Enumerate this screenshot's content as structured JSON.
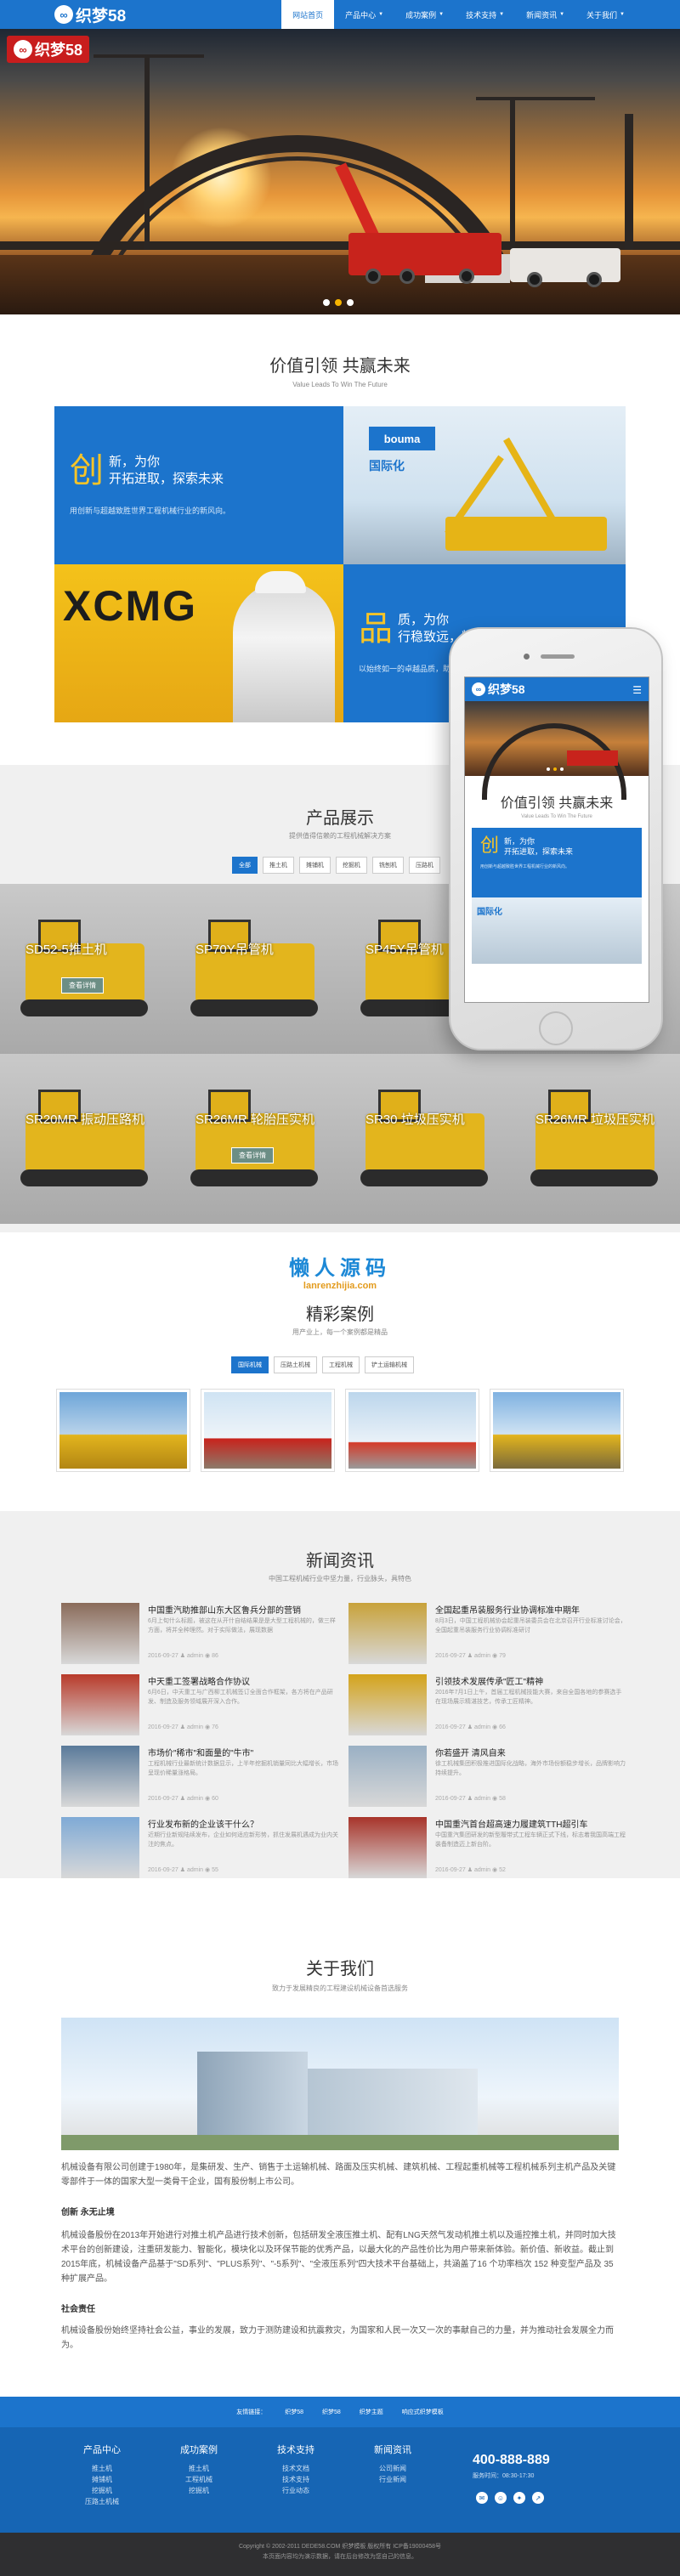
{
  "header": {
    "logo_text": "织梦58",
    "nav": [
      {
        "label": "网站首页",
        "active": true,
        "dropdown": false
      },
      {
        "label": "产品中心",
        "active": false,
        "dropdown": true
      },
      {
        "label": "成功案例",
        "active": false,
        "dropdown": true
      },
      {
        "label": "技术支持",
        "active": false,
        "dropdown": true
      },
      {
        "label": "新闻资讯",
        "active": false,
        "dropdown": true
      },
      {
        "label": "关于我们",
        "active": false,
        "dropdown": true
      }
    ]
  },
  "hero": {
    "logo_text": "织梦58",
    "slide_count": 3,
    "active_slide": 2
  },
  "value": {
    "title": "价值引领 共赢未来",
    "subtitle": "Value Leads To Win The Future",
    "block1": {
      "big": "创",
      "line1": "新，为你",
      "line2": "开拓进取，探索未来",
      "desc": "用创新与超越致胜世界工程机械行业的新风向。"
    },
    "block2": {
      "big": "品",
      "line1": "质，为你",
      "line2": "行稳致远，精益求精",
      "desc": "以始终如一的卓越品质，助力客户成就非凡未来。"
    },
    "bouma_label": "国际化",
    "xcmg_label": "XCMG"
  },
  "products": {
    "title": "产品展示",
    "subtitle": "提供值得信赖的工程机械解决方案",
    "tabs": [
      "全部",
      "推土机",
      "摊铺机",
      "挖掘机",
      "铣刨机",
      "压路机"
    ],
    "items": [
      {
        "name": "SD52-5推土机",
        "show_btn": true,
        "btn": "查看详情"
      },
      {
        "name": "SP70Y吊管机",
        "show_btn": false,
        "btn": ""
      },
      {
        "name": "SP45Y吊管机",
        "show_btn": false,
        "btn": ""
      },
      {
        "name": "",
        "show_btn": false,
        "btn": ""
      },
      {
        "name": "SR20MR 振动压路机",
        "show_btn": false,
        "btn": ""
      },
      {
        "name": "SR26MR 轮胎压实机",
        "show_btn": true,
        "btn": "查看详情"
      },
      {
        "name": "SR30 垃圾压实机",
        "show_btn": false,
        "btn": ""
      },
      {
        "name": "SR26MR 垃圾压实机",
        "show_btn": false,
        "btn": ""
      }
    ]
  },
  "phone": {
    "logo_text": "织梦58",
    "title": "价值引领 共赢未来",
    "subtitle": "Value Leads To Win The Future",
    "big": "创",
    "line1": "新，为你",
    "line2": "开拓进取，探索未来",
    "desc": "用创新与超越致胜世界工程机械行业的新风向。",
    "img_label": "国际化"
  },
  "watermark": {
    "line1": "懒人源码",
    "line2": "lanrenzhijia.com"
  },
  "cases": {
    "title": "精彩案例",
    "subtitle": "用产业上，每一个案例都是精品",
    "tabs": [
      "国际机械",
      "压路土机械",
      "工程机械",
      "铲土运输机械"
    ]
  },
  "news": {
    "title": "新闻资讯",
    "subtitle": "中国工程机械行业中坚力量，行业脉头，具特色",
    "items": [
      {
        "title": "中国重汽助推部山东大区鲁兵分部的营销",
        "desc": "6月上旬什么标题，被这在从开什自结结果是是大型工程机械的，做三样方面，将并全种理然。对于实际做法，展现数据",
        "date": "2016-09-27",
        "author": "admin",
        "views": "86"
      },
      {
        "title": "全国起重吊装服务行业协调标准中期年",
        "desc": "8月3日，中国工程机械协会起重吊装委员会在北京召开行业标准讨论会，全国起重吊装服务行业协调标准研讨",
        "date": "2016-09-27",
        "author": "admin",
        "views": "79"
      },
      {
        "title": "中天重工签署战略合作协议",
        "desc": "6月6日，中天重工与广西柳工机械签订全面合作框架，各方将在产品研发、制造及服务领域展开深入合作。",
        "date": "2016-09-27",
        "author": "admin",
        "views": "76"
      },
      {
        "title": "引领技术发展传承\"匠工\"精神",
        "desc": "2016年7月1日上午，首届工程机械技能大赛，来自全国各地的参赛选手在现场展示精湛技艺，传承工匠精神。",
        "date": "2016-09-27",
        "author": "admin",
        "views": "66"
      },
      {
        "title": "市场价\"稀市\"和面量的\"牛市\"",
        "desc": "工程机械行业最新统计数据显示，上半年挖掘机销量同比大幅增长，市场呈现价稀量涨格局。",
        "date": "2016-09-27",
        "author": "admin",
        "views": "60"
      },
      {
        "title": "你若盛开 清风自来",
        "desc": "徐工机械集团积极推进国际化战略，海外市场份额稳步增长，品牌影响力持续提升。",
        "date": "2016-09-27",
        "author": "admin",
        "views": "58"
      },
      {
        "title": "行业发布新的企业该干什么？",
        "desc": "近期行业新规陆续发布，企业如何适应新形势，抓住发展机遇成为业内关注的焦点。",
        "date": "2016-09-27",
        "author": "admin",
        "views": "55"
      },
      {
        "title": "中国重汽首台超高速力履建筑TTH超引车",
        "desc": "中国重汽集团研发的新型履带式工程车辆正式下线，标志着我国高端工程装备制造迈上新台阶。",
        "date": "2016-09-27",
        "author": "admin",
        "views": "52"
      }
    ]
  },
  "about": {
    "title": "关于我们",
    "subtitle": "致力于发展精良的工程建设机械设备首选服务",
    "intro": "机械设备有限公司创建于1980年，是集研发、生产、销售于土运输机械、路面及压实机械、建筑机械、工程起重机械等工程机械系列主机产品及关键零部件于一体的国家大型一类骨干企业，国有股份制上市公司。",
    "h1": "创新 永无止境",
    "p1": "机械设备股份在2013年开始进行对推土机产品进行技术创新，包括研发全液压推土机、配有LNG天然气发动机推土机以及遥控推土机，并同时加大技术平台的创新建设，注重研发能力、智能化，模块化以及环保节能的优秀产品，以最大化的产品性价比为用户带来新体验。新价值、新收益。截止到2015年底，机械设备产品基于\"SD系列\"、\"PLUS系列\"、\"-5系列\"、\"全液压系列\"四大技术平台基础上，共涵盖了16 个功率档次 152 种变型产品及 35 种扩展产品。",
    "h2": "社会责任",
    "p2": "机械设备股份始终坚持社会公益，事业的发展，致力于测防建设和抗震救灾，为国家和人民一次又一次的事献自己的力量，并为推动社会发展全力而为。"
  },
  "footer": {
    "links": [
      "友情链接：",
      "织梦58",
      "织梦58",
      "织梦主题",
      "响应式织梦模板"
    ],
    "cols": [
      {
        "head": "产品中心",
        "items": [
          "推土机",
          "摊铺机",
          "挖掘机",
          "压路土机械"
        ]
      },
      {
        "head": "成功案例",
        "items": [
          "推土机",
          "工程机械",
          "挖掘机"
        ]
      },
      {
        "head": "技术支持",
        "items": [
          "技术文档",
          "技术支持",
          "行业动态"
        ]
      },
      {
        "head": "新闻资讯",
        "items": [
          "公司新闻",
          "行业新闻"
        ]
      }
    ],
    "phone": "400-888-889",
    "hours": "服务时间：08:30-17:30",
    "copyright": "Copyright © 2002-2011 DEDE58.COM 织梦模板 版权所有 ICP备19000458号",
    "note": "本页面内容均为演示数据，请在后台修改为您自己的信息。"
  },
  "colors": {
    "primary": "#1c74cc",
    "accent": "#f6c428",
    "dark": "#2f2f31"
  }
}
